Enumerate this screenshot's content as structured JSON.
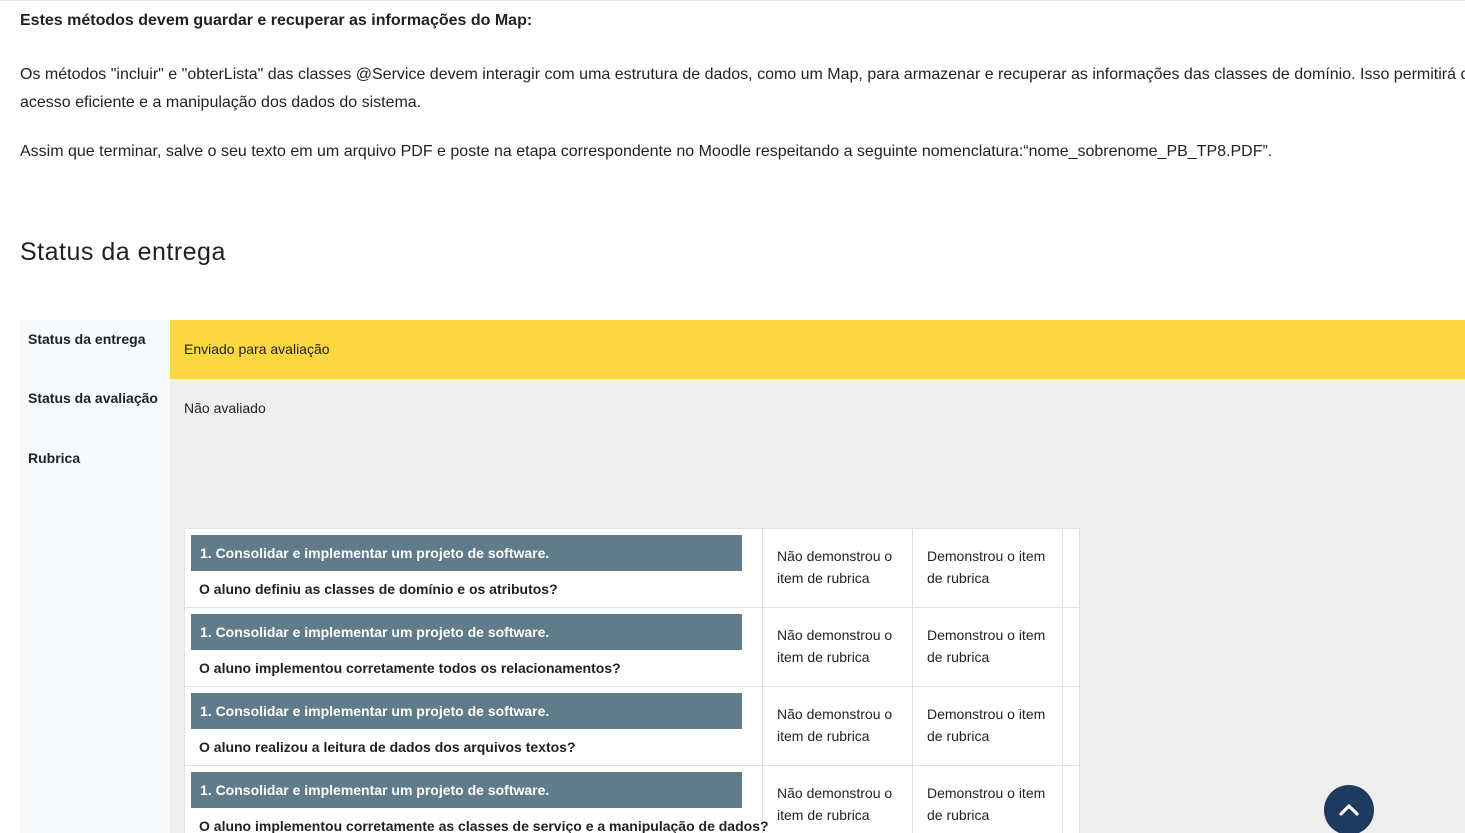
{
  "intro": {
    "heading": "Estes métodos devem guardar e recuperar as informações do Map:",
    "paragraph1": "Os métodos \"incluir\" e \"obterLista\" das classes @Service devem interagir com uma estrutura de dados, como um Map, para armazenar e recuperar as informações das classes de domínio. Isso permitirá o acesso eficiente e a manipulação dos dados do sistema.",
    "paragraph2": "Assim que terminar, salve o seu texto em um arquivo PDF e poste na etapa correspondente no Moodle respeitando a seguinte nomenclatura:“nome_sobrenome_PB_TP8.PDF”."
  },
  "section_title": "Status da entrega",
  "status": {
    "submission_label": "Status da entrega",
    "submission_value": "Enviado para avaliação",
    "grading_label": "Status da avaliação",
    "grading_value": "Não avaliado",
    "rubric_label": "Rubrica"
  },
  "rubric": {
    "rows": [
      {
        "criterion": "1. Consolidar e implementar um projeto de software.",
        "description": "O aluno definiu as classes de domínio e os atributos?",
        "level1": "Não demonstrou o item de rubrica",
        "level2": "Demonstrou o item de rubrica"
      },
      {
        "criterion": "1. Consolidar e implementar um projeto de software.",
        "description": "O aluno implementou corretamente todos os relacionamentos?",
        "level1": "Não demonstrou o item de rubrica",
        "level2": "Demonstrou o item de rubrica"
      },
      {
        "criterion": "1. Consolidar e implementar um projeto de software.",
        "description": "O aluno realizou a leitura de dados dos arquivos textos?",
        "level1": "Não demonstrou o item de rubrica",
        "level2": "Demonstrou o item de rubrica"
      },
      {
        "criterion": "1. Consolidar e implementar um projeto de software.",
        "description": "O aluno implementou corretamente as classes de serviço e a manipulação de dados?",
        "level1": "Não demonstrou o item de rubrica",
        "level2": "Demonstrou o item de rubrica"
      }
    ]
  },
  "colors": {
    "submitted_highlight": "#fdd73f",
    "criterion_header": "#607b8a",
    "back_to_top": "#1e3a5f"
  },
  "icons": {
    "back_to_top": "chevron-up-icon"
  }
}
